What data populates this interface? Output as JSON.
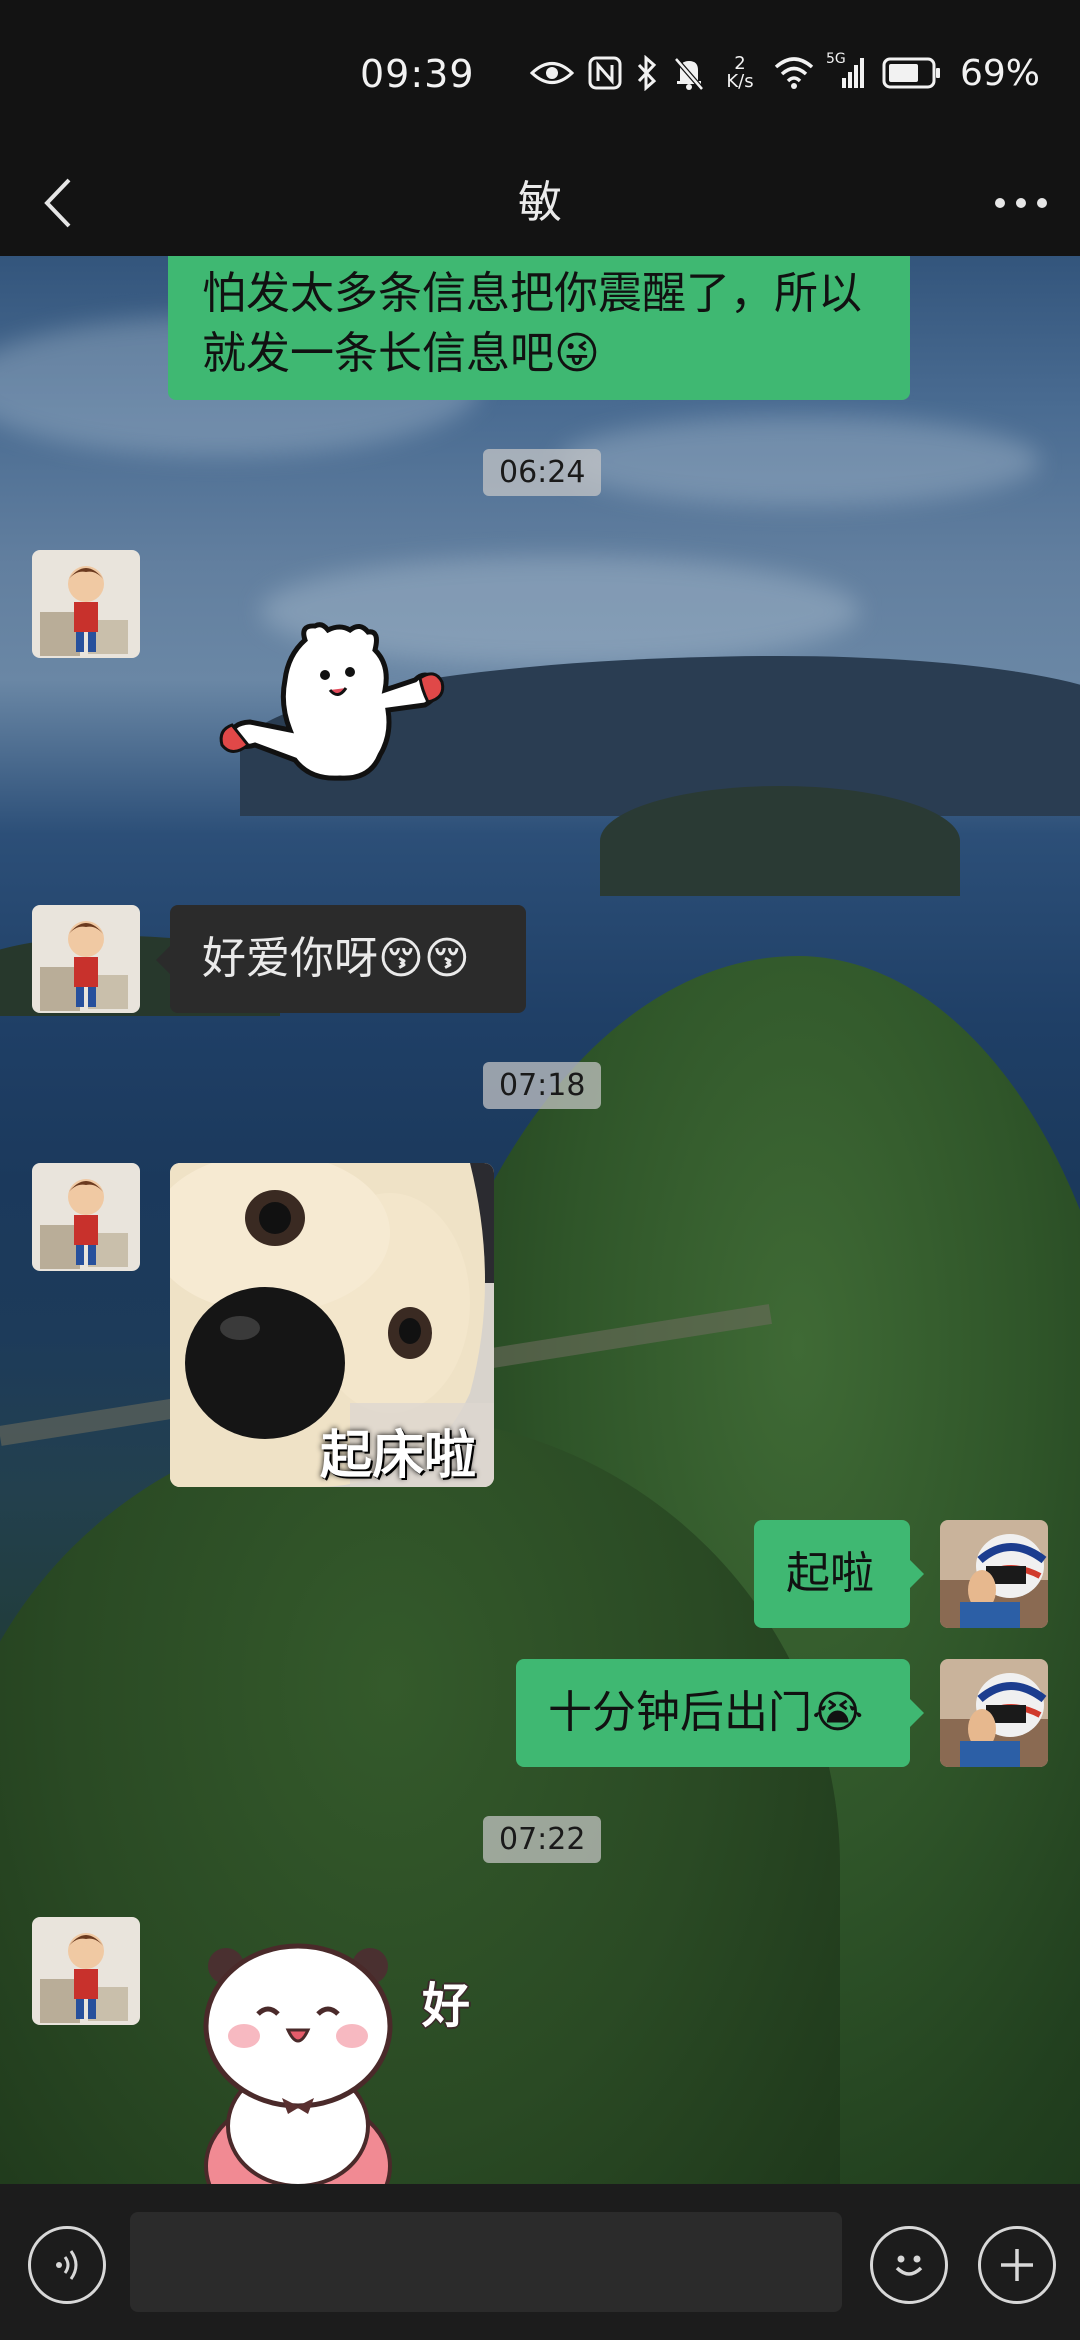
{
  "status_bar": {
    "time": "09:39",
    "speed_value": "2",
    "speed_unit": "K/s",
    "network": "5G",
    "battery": "69%"
  },
  "header": {
    "title": "敏",
    "back_icon": "chevron-left-icon",
    "more_icon": "more-dots-icon"
  },
  "messages": {
    "m1_text": "怕发太多条信息把你震醒了，所以就发一条长信息吧😜",
    "time1": "06:24",
    "m2_sticker": "bear-sticker",
    "m3_text": "好爱你呀😚😚",
    "time2": "07:18",
    "m4_image_caption": "起床啦",
    "m5_text": "起啦",
    "m6_text": "十分钟后出门😭",
    "time3": "07:22",
    "m7_sticker_text": "好"
  },
  "bottom_bar": {
    "voice_icon": "voice-icon",
    "emoji_icon": "emoji-icon",
    "plus_icon": "plus-icon"
  },
  "colors": {
    "accent": "#3fb872",
    "bar_bg": "#131313"
  }
}
